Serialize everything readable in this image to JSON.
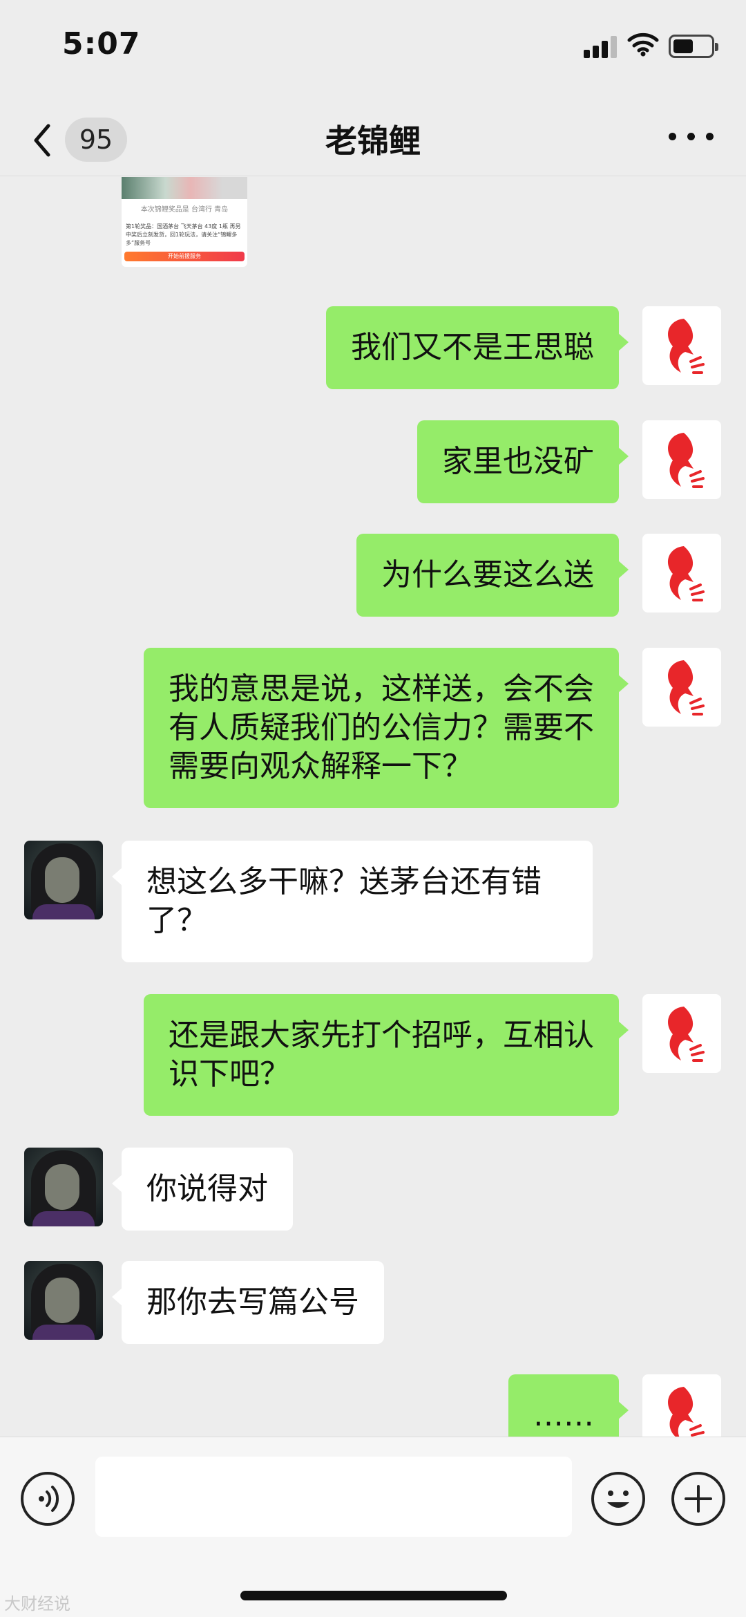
{
  "status_bar": {
    "time": "5:07",
    "battery_level": 0.5
  },
  "nav": {
    "unread_count": "95",
    "title": "老锦鲤"
  },
  "card_preview": {
    "caption": "本次锦鲤奖品是 台湾行 青岛",
    "text": "第1轮奖品：国酒茅台 飞天茅台 43度 1瓶 再另 中奖后立刻发货，回1轮玩法，请关注“锦鲤多多”服务号",
    "button": "开始前援服务"
  },
  "messages": [
    {
      "from": "self",
      "text": "我们又不是王思聪"
    },
    {
      "from": "self",
      "text": "家里也没矿"
    },
    {
      "from": "self",
      "text": "为什么要这么送"
    },
    {
      "from": "self",
      "text": "我的意思是说，这样送，会不会\n有人质疑我们的公信力？需要不\n需要向观众解释一下？"
    },
    {
      "from": "other",
      "text": "想这么多干嘛？送茅台还有错\n了？"
    },
    {
      "from": "self",
      "text": "还是跟大家先打个招呼，互相认\n识下吧？"
    },
    {
      "from": "other",
      "text": "你说得对"
    },
    {
      "from": "other",
      "text": "那你去写篇公号"
    },
    {
      "from": "self",
      "text": "……"
    }
  ],
  "input": {
    "value": ""
  },
  "watermark": "大财经说",
  "colors": {
    "self_bubble": "#95ec69",
    "other_bubble": "#ffffff",
    "background": "#ededed",
    "logo_red": "#e8262a"
  },
  "icons": {
    "back": "chevron-left-icon",
    "more": "more-dots-icon",
    "voice": "voice-icon",
    "emoji": "emoji-icon",
    "plus": "plus-icon",
    "signal": "signal-icon",
    "wifi": "wifi-icon",
    "battery": "battery-icon"
  }
}
